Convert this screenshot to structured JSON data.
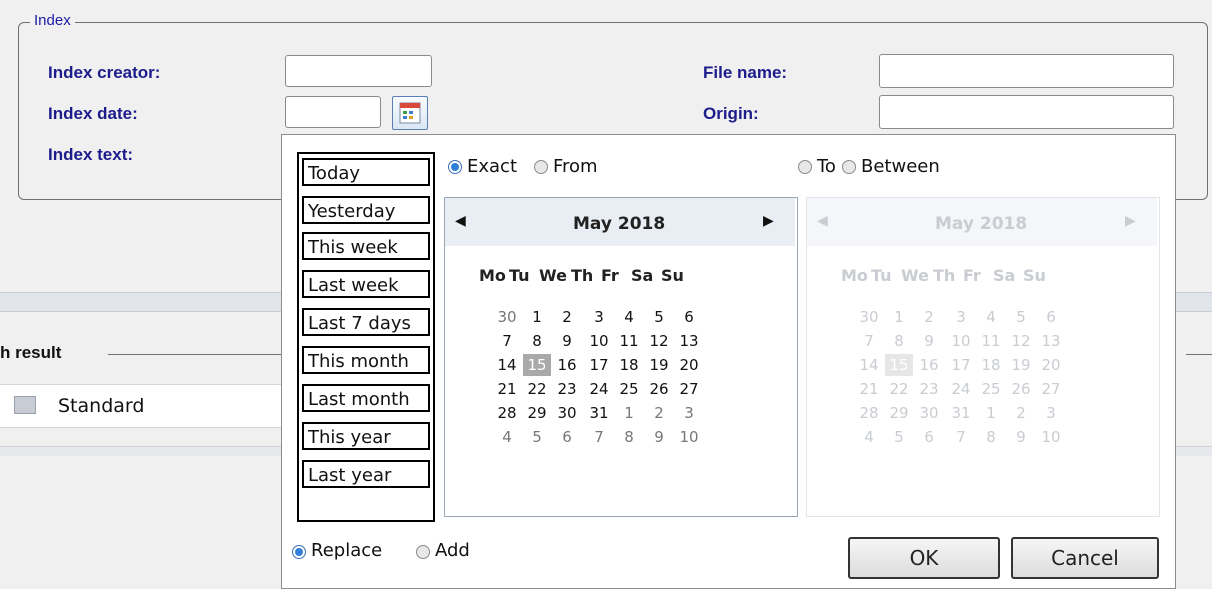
{
  "index": {
    "legend": "Index",
    "creator_label": "Index creator:",
    "date_label": "Index date:",
    "text_label": "Index text:",
    "file_name_label": "File name:",
    "origin_label": "Origin:",
    "creator_value": "",
    "date_value": "",
    "file_name_value": "",
    "origin_value": ""
  },
  "search_result": {
    "label": "h result",
    "view": "Standard"
  },
  "popup": {
    "presets": [
      "Today",
      "Yesterday",
      "This week",
      "Last week",
      "Last 7 days",
      "This month",
      "Last month",
      "This year",
      "Last year"
    ],
    "mode": {
      "exact": "Exact",
      "from": "From",
      "to": "To",
      "between": "Between",
      "selected": "Exact"
    },
    "calendar_left": {
      "title": "May 2018",
      "weekdays": [
        "Mo",
        "Tu",
        "We",
        "Th",
        "Fr",
        "Sa",
        "Su"
      ],
      "weeks": [
        [
          "30",
          "1",
          "2",
          "3",
          "4",
          "5",
          "6"
        ],
        [
          "7",
          "8",
          "9",
          "10",
          "11",
          "12",
          "13"
        ],
        [
          "14",
          "15",
          "16",
          "17",
          "18",
          "19",
          "20"
        ],
        [
          "21",
          "22",
          "23",
          "24",
          "25",
          "26",
          "27"
        ],
        [
          "28",
          "29",
          "30",
          "31",
          "1",
          "2",
          "3"
        ],
        [
          "4",
          "5",
          "6",
          "7",
          "8",
          "9",
          "10"
        ]
      ],
      "selected_day": "15"
    },
    "calendar_right": {
      "title": "May 2018",
      "weekdays": [
        "Mo",
        "Tu",
        "We",
        "Th",
        "Fr",
        "Sa",
        "Su"
      ],
      "weeks": [
        [
          "30",
          "1",
          "2",
          "3",
          "4",
          "5",
          "6"
        ],
        [
          "7",
          "8",
          "9",
          "10",
          "11",
          "12",
          "13"
        ],
        [
          "14",
          "15",
          "16",
          "17",
          "18",
          "19",
          "20"
        ],
        [
          "21",
          "22",
          "23",
          "24",
          "25",
          "26",
          "27"
        ],
        [
          "28",
          "29",
          "30",
          "31",
          "1",
          "2",
          "3"
        ],
        [
          "4",
          "5",
          "6",
          "7",
          "8",
          "9",
          "10"
        ]
      ],
      "selected_day": "15"
    },
    "action": {
      "replace": "Replace",
      "add": "Add",
      "selected": "Replace"
    },
    "ok_label": "OK",
    "cancel_label": "Cancel"
  }
}
